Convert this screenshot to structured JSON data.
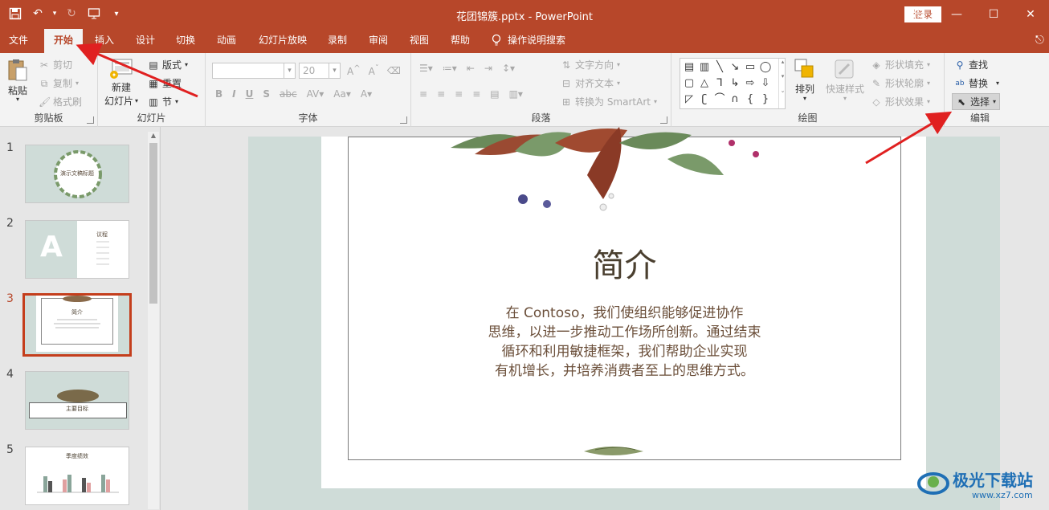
{
  "window": {
    "title": "花团锦簇.pptx  -  PowerPoint",
    "login_label": "登录",
    "controls": [
      "ribbon-display",
      "minimize",
      "maximize",
      "close"
    ]
  },
  "tabs": [
    {
      "label": "文件"
    },
    {
      "label": "开始",
      "active": true
    },
    {
      "label": "插入"
    },
    {
      "label": "设计"
    },
    {
      "label": "切换"
    },
    {
      "label": "动画"
    },
    {
      "label": "幻灯片放映"
    },
    {
      "label": "录制"
    },
    {
      "label": "审阅"
    },
    {
      "label": "视图"
    },
    {
      "label": "帮助"
    }
  ],
  "tell_me": "操作说明搜索",
  "ribbon": {
    "clipboard": {
      "label": "剪贴板",
      "paste": "粘贴",
      "cut": "剪切",
      "copy": "复制",
      "format_painter": "格式刷"
    },
    "slides": {
      "label": "幻灯片",
      "new_slide_line1": "新建",
      "new_slide_line2": "幻灯片",
      "layout": "版式",
      "reset": "重置",
      "section": "节"
    },
    "font": {
      "label": "字体",
      "font_name": "",
      "font_size": "20"
    },
    "paragraph": {
      "label": "段落",
      "text_direction": "文字方向",
      "align_text": "对齐文本",
      "smartart": "转换为 SmartArt"
    },
    "drawing": {
      "label": "绘图",
      "arrange": "排列",
      "quick_styles": "快速样式",
      "shape_fill": "形状填充",
      "shape_outline": "形状轮廓",
      "shape_effects": "形状效果"
    },
    "editing": {
      "label": "编辑",
      "find": "查找",
      "replace": "替换",
      "select": "选择"
    }
  },
  "thumbnails": [
    {
      "number": "1",
      "title": "演示文稿标题"
    },
    {
      "number": "2",
      "title": "议程",
      "big_letter": "A"
    },
    {
      "number": "3",
      "title": "简介",
      "selected": true
    },
    {
      "number": "4",
      "title": "主要目标"
    },
    {
      "number": "5",
      "title": "季度绩效"
    }
  ],
  "slide": {
    "title": "简介",
    "body_lines": [
      "在 Contoso，我们使组织能够促进协作",
      "思维，以进一步推动工作场所创新。通过结束",
      "循环和利用敏捷框架，我们帮助企业实现",
      "有机增长，并培养消费者至上的思维方式。"
    ]
  },
  "watermark": {
    "text": "极光下载站",
    "url": "www.xz7.com"
  },
  "colors": {
    "accent": "#b7472a",
    "slide_bg": "#cfdcd8",
    "arrow": "#e02020"
  }
}
